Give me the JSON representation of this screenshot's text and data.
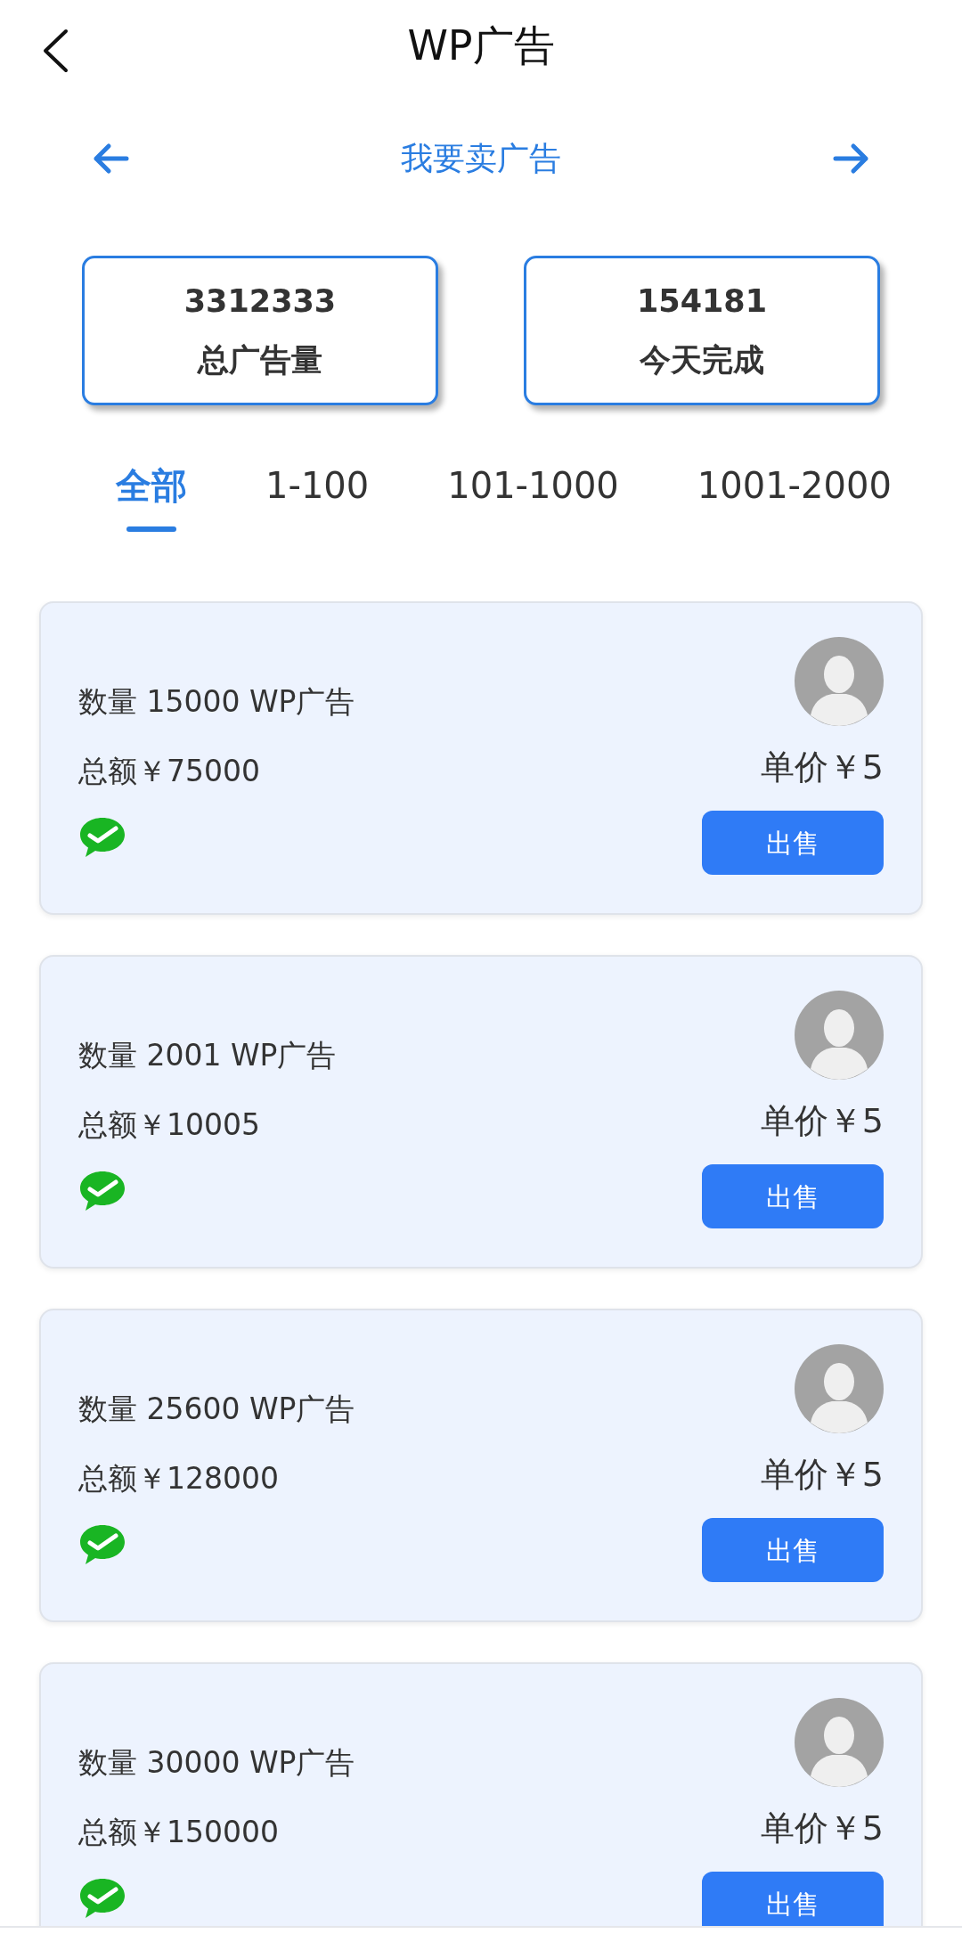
{
  "header": {
    "title": "WP广告"
  },
  "switcher": {
    "label": "我要卖广告"
  },
  "stats": [
    {
      "value": "3312333",
      "label": "总广告量"
    },
    {
      "value": "154181",
      "label": "今天完成"
    }
  ],
  "tabs": [
    {
      "label": "全部",
      "selected": true
    },
    {
      "label": "1-100",
      "selected": false
    },
    {
      "label": "101-1000",
      "selected": false
    },
    {
      "label": "1001-2000",
      "selected": false
    }
  ],
  "orders": [
    {
      "quantity": "数量 15000 WP广告",
      "total": "总额￥75000",
      "price": "单价￥5",
      "action": "出售"
    },
    {
      "quantity": "数量 2001 WP广告",
      "total": "总额￥10005",
      "price": "单价￥5",
      "action": "出售"
    },
    {
      "quantity": "数量 25600 WP广告",
      "total": "总额￥128000",
      "price": "单价￥5",
      "action": "出售"
    },
    {
      "quantity": "数量 30000 WP广告",
      "total": "总额￥150000",
      "price": "单价￥5",
      "action": "出售"
    }
  ]
}
